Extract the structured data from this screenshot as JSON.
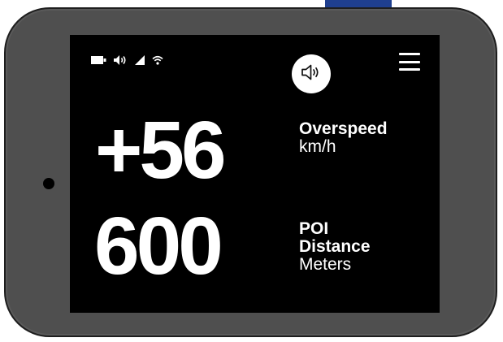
{
  "device": {
    "frame_color": "#4f4f4f",
    "screen_color": "#000000",
    "accent_tab_color": "#1f3f8f"
  },
  "status_bar": {
    "icons": [
      "battery-icon",
      "volume-icon",
      "signal-icon",
      "wifi-icon"
    ]
  },
  "controls": {
    "sound_button_icon": "speaker-icon",
    "menu_icon": "hamburger-menu-icon"
  },
  "overspeed": {
    "value": "+56",
    "label": "Overspeed",
    "unit": "km/h"
  },
  "poi": {
    "value": "600",
    "label_line1": "POI",
    "label_line2": "Distance",
    "unit": "Meters"
  }
}
